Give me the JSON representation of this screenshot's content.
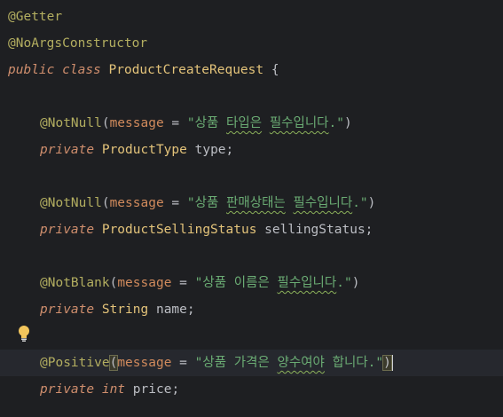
{
  "code": {
    "l1": {
      "annotation": "@Getter"
    },
    "l2": {
      "annotation": "@NoArgsConstructor"
    },
    "l3": {
      "kw1": "public",
      "kw2": "class",
      "class_name": "ProductCreateRequest",
      "brace": "{"
    },
    "l5": {
      "annotation": "@NotNull",
      "open": "(",
      "param": "message",
      "eq": " = ",
      "q1": "\"",
      "s1": "상품 ",
      "s2": "타입은",
      "s3": " ",
      "s4": "필수입니다",
      "s5": ".\"",
      "close": ")"
    },
    "l6": {
      "kw": "private",
      "type": "ProductType",
      "name": " type",
      "semi": ";"
    },
    "l8": {
      "annotation": "@NotNull",
      "open": "(",
      "param": "message",
      "eq": " = ",
      "q1": "\"",
      "s1": "상품 ",
      "s2": "판매상태는",
      "s3": " ",
      "s4": "필수입니다",
      "s5": ".\"",
      "close": ")"
    },
    "l9": {
      "kw": "private",
      "type": "ProductSellingStatus",
      "name": " sellingStatus",
      "semi": ";"
    },
    "l11": {
      "annotation": "@NotBlank",
      "open": "(",
      "param": "message",
      "eq": " = ",
      "q1": "\"",
      "s1": "상품 이름은 ",
      "s4": "필수입니다",
      "s5": ".\"",
      "close": ")"
    },
    "l12": {
      "kw": "private",
      "type": "String",
      "name": " name",
      "semi": ";"
    },
    "l14": {
      "annotation": "@Positive",
      "open": "(",
      "param": "message",
      "eq": " = ",
      "q1": "\"",
      "s1": "상품 가격은 ",
      "s4": "양수여야",
      "s5": " 합니다.\"",
      "close": ")"
    },
    "l15": {
      "kw1": "private",
      "kw2": "int",
      "name": " price",
      "semi": ";"
    }
  },
  "icons": {
    "intention": "lightbulb-icon"
  },
  "colors": {
    "background": "#1e1f22",
    "annotation": "#b3ae60",
    "keyword": "#cf8e6d",
    "string": "#6aab73",
    "parameter": "#d08a5c",
    "class": "#e3c37a",
    "current_line": "#26282e"
  }
}
